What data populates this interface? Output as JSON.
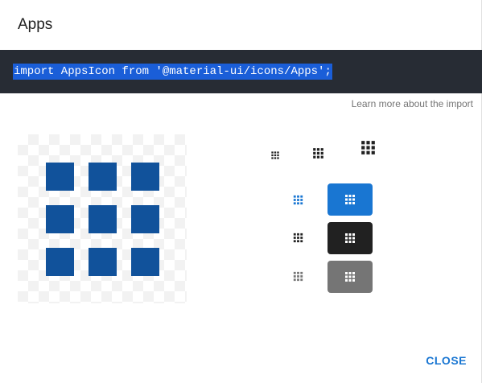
{
  "dialog": {
    "title": "Apps",
    "code": "import AppsIcon from '@material-ui/icons/Apps';",
    "learn_more": "Learn more about the import",
    "close_label": "CLOSE"
  },
  "preview": {
    "icon": "apps-icon",
    "color": "#11529b"
  },
  "sizes": [
    {
      "name": "small",
      "icon": "apps-icon"
    },
    {
      "name": "medium",
      "icon": "apps-icon"
    },
    {
      "name": "large",
      "icon": "apps-icon"
    }
  ],
  "variants": [
    {
      "name": "primary",
      "color": "#1976d2",
      "bg": "#1976d2",
      "fg": "#ffffff"
    },
    {
      "name": "default",
      "color": "#212121",
      "bg": "#212121",
      "fg": "#ffffff"
    },
    {
      "name": "disabled",
      "color": "#757575",
      "bg": "#757575",
      "fg": "#ffffff"
    }
  ],
  "colors": {
    "accent": "#1976d2",
    "code_bg": "#272c34",
    "selection": "#1a5ed8"
  }
}
